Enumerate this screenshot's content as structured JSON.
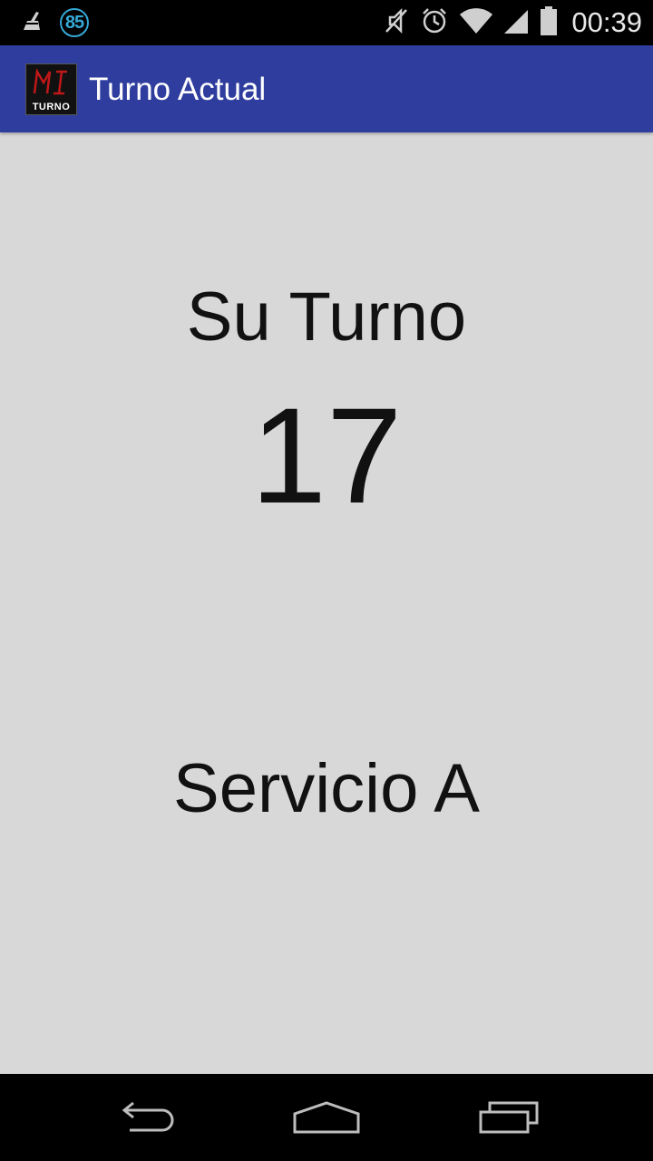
{
  "status_bar": {
    "notification_count": "85",
    "time": "00:39",
    "icons": [
      "cleaner-icon",
      "notification-badge",
      "mute-icon",
      "alarm-icon",
      "wifi-icon",
      "signal-icon",
      "battery-icon"
    ]
  },
  "app_bar": {
    "logo_text": "TURNO",
    "logo_mark": "MI",
    "title": "Turno Actual",
    "color": "#2f3e9e"
  },
  "main": {
    "label": "Su Turno",
    "number": "17",
    "service": "Servicio A",
    "background": "#d8d8d8"
  },
  "nav_bar": {
    "buttons": [
      "back-icon",
      "home-icon",
      "recents-icon"
    ]
  }
}
